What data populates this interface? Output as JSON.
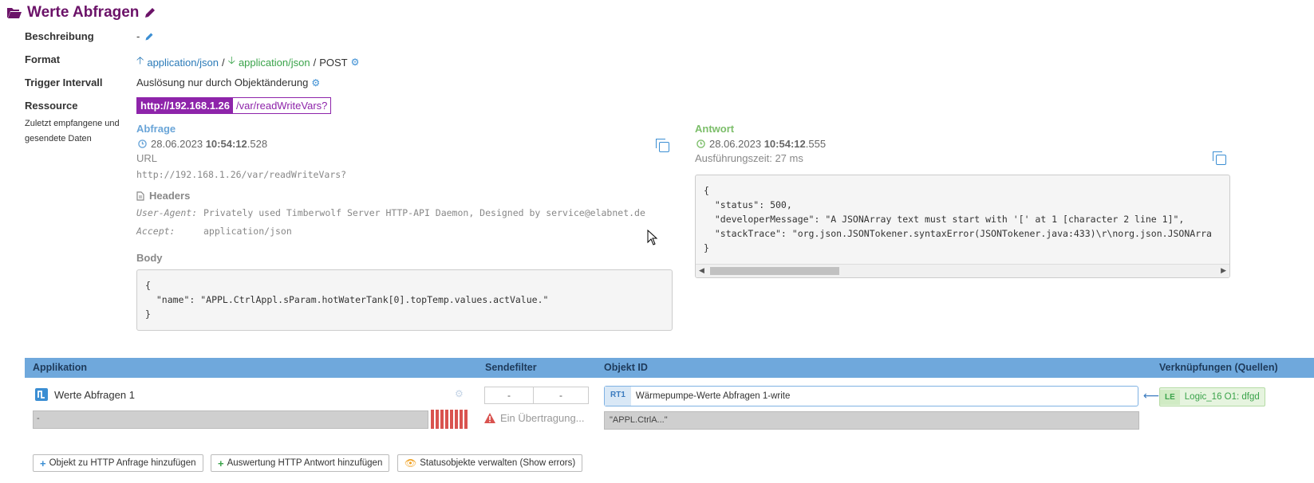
{
  "page": {
    "title": "Werte Abfragen"
  },
  "fields": {
    "beschreibung_label": "Beschreibung",
    "beschreibung_value": "-",
    "format_label": "Format",
    "format_in": "application/json",
    "format_sep1": "/",
    "format_out": "application/json",
    "format_sep2": "/",
    "format_method": "POST",
    "trigger_label": "Trigger Intervall",
    "trigger_value": "Auslösung nur durch Objektänderung",
    "ressource_label": "Ressource",
    "ressource_hint": "Zuletzt empfangene und gesendete Daten",
    "ressource_host": "http://192.168.1.26",
    "ressource_path": "/var/readWriteVars?"
  },
  "request": {
    "heading": "Abfrage",
    "date": "28.06.2023",
    "time_bold": "10:54:12",
    "time_ms": ".528",
    "url_label": "URL",
    "url_value": "http://192.168.1.26/var/readWriteVars?",
    "headers_label": "Headers",
    "header1_key": "User-Agent:",
    "header1_value": "Privately used Timberwolf Server HTTP-API Daemon, Designed by service@elabnet.de",
    "header2_key": "Accept:",
    "header2_value": "application/json",
    "body_label": "Body",
    "body_code": "{\n  \"name\": \"APPL.CtrlAppl.sParam.hotWaterTank[0].topTemp.values.actValue.\"\n}"
  },
  "response": {
    "heading": "Antwort",
    "date": "28.06.2023",
    "time_bold": "10:54:12",
    "time_ms": ".555",
    "exec_time": "Ausführungszeit: 27 ms",
    "body_code": "{\n  \"status\": 500,\n  \"developerMessage\": \"A JSONArray text must start with '[' at 1 [character 2 line 1]\",\n  \"stackTrace\": \"org.json.JSONTokener.syntaxError(JSONTokener.java:433)\\r\\norg.json.JSONArra\n}"
  },
  "table": {
    "col_app": "Applikation",
    "col_filter": "Sendefilter",
    "col_object": "Objekt ID",
    "col_links": "Verknüpfungen (Quellen)",
    "row": {
      "app_name": "Werte Abfragen 1",
      "app_value": "-",
      "filter_min": "-",
      "filter_max": "-",
      "warning": "Ein Übertragung...",
      "object_badge": "RT1",
      "object_name": "Wärmepumpe-Werte Abfragen 1-write",
      "object_value": "\"APPL.CtrlA...\"",
      "link_badge": "LE",
      "link_name": "Logic_16 O1: dfgd"
    }
  },
  "buttons": {
    "add_request": "Objekt zu HTTP Anfrage hinzufügen",
    "add_response": "Auswertung HTTP Antwort hinzufügen",
    "status": "Statusobjekte verwalten (Show errors)"
  },
  "colors": {
    "title": "#6b1268",
    "resource": "#8e24aa",
    "table_header": "#6fa8dc",
    "request_heading": "#6aa5d8",
    "response_heading": "#7cbe6a",
    "status_bars": "#d9534f"
  }
}
